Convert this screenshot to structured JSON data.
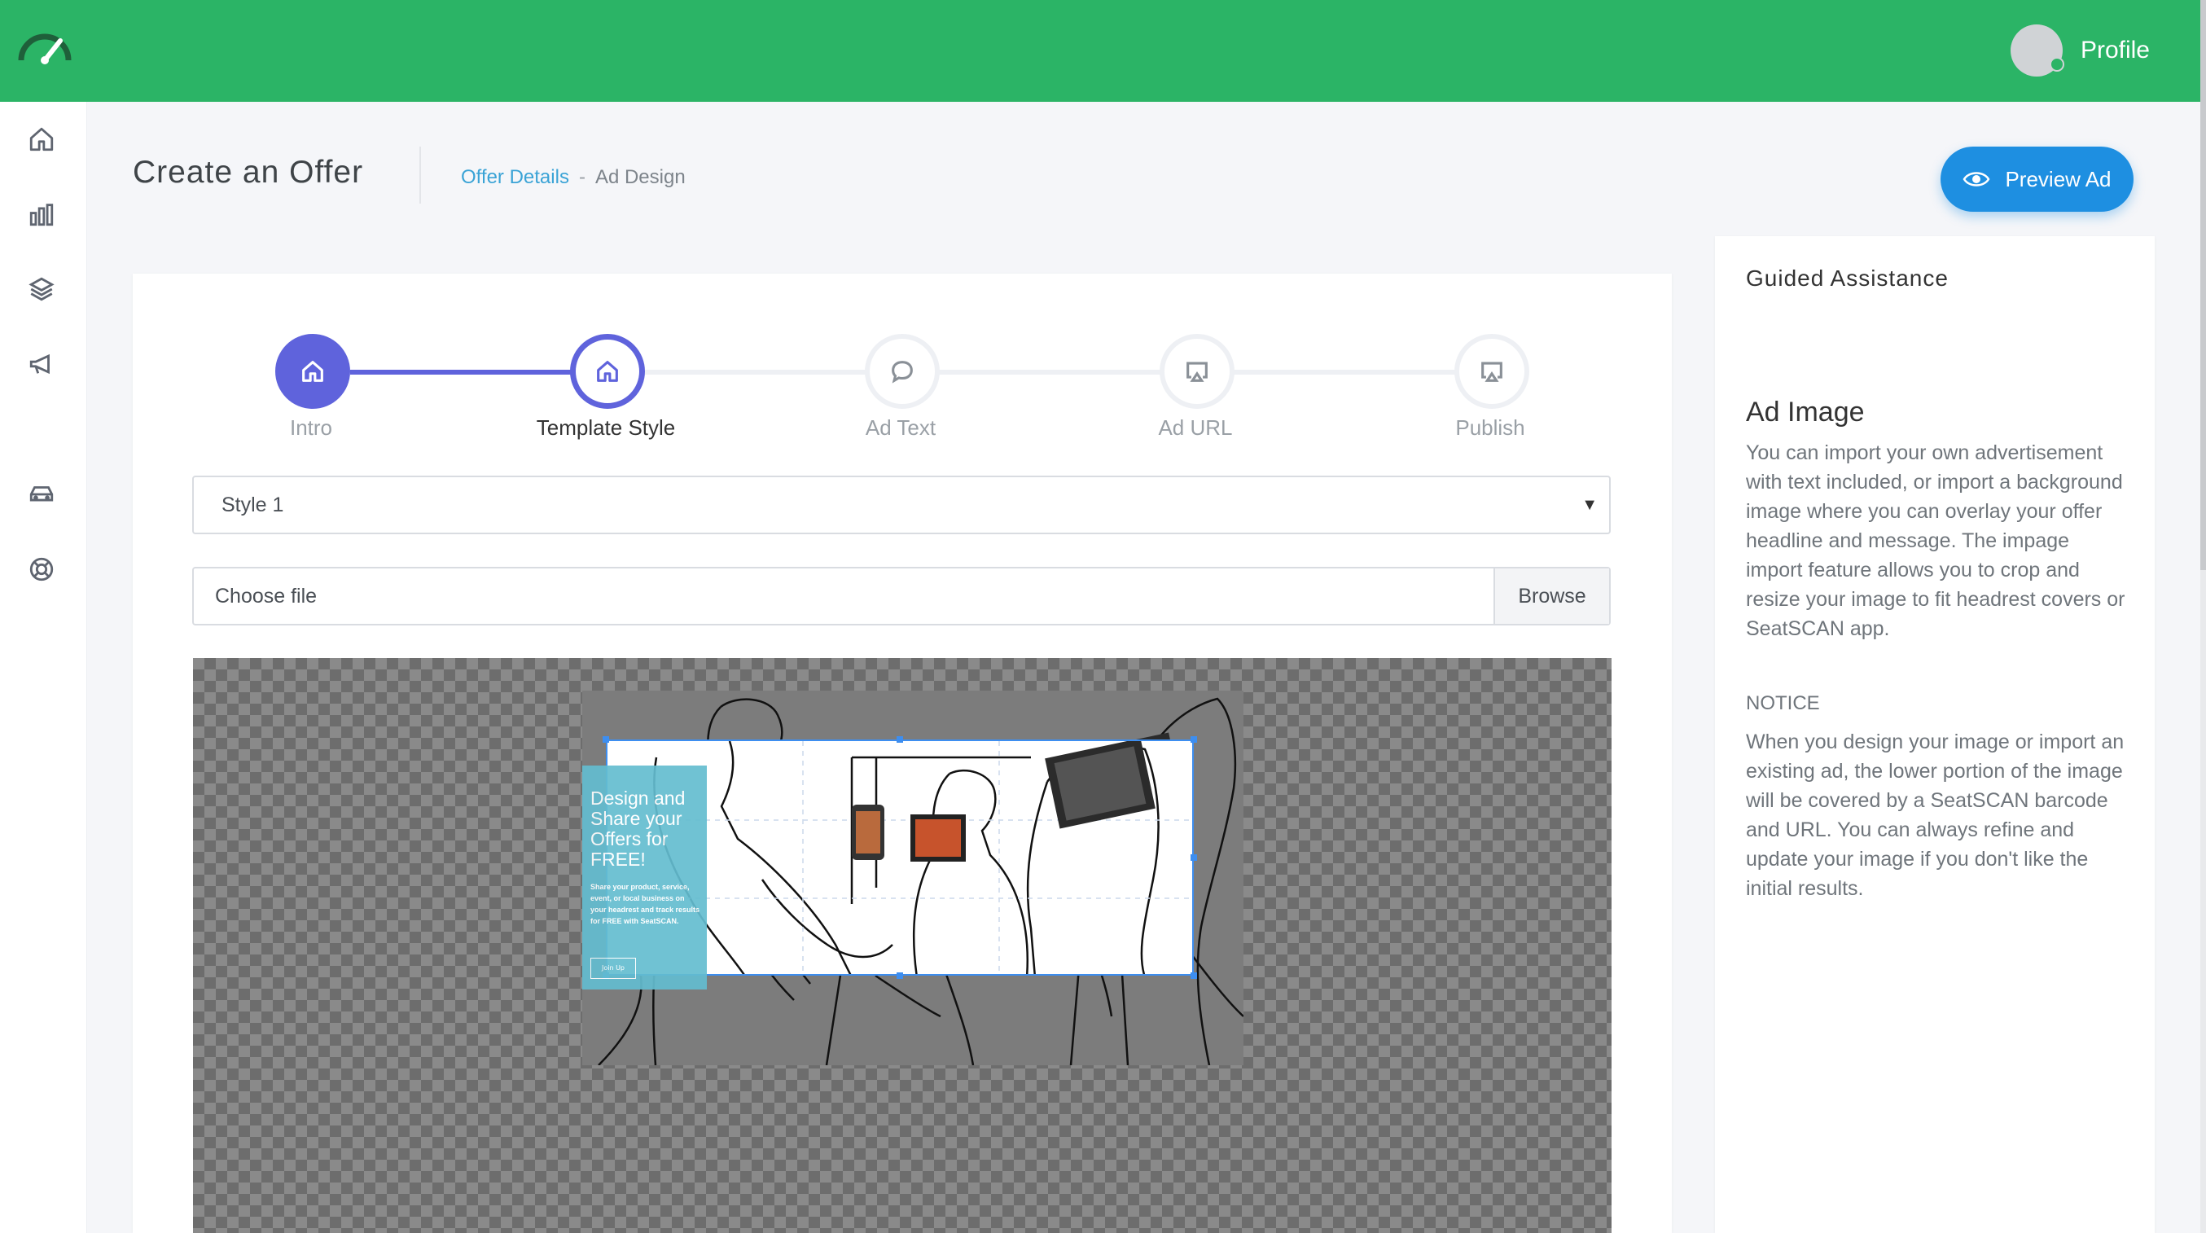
{
  "header": {
    "profile_label": "Profile",
    "brand_color": "#2bb466"
  },
  "sidebar": {
    "items": [
      {
        "icon": "home-icon"
      },
      {
        "icon": "bar-chart-icon"
      },
      {
        "icon": "layers-icon"
      },
      {
        "icon": "megaphone-icon"
      },
      {
        "icon": "car-icon"
      },
      {
        "icon": "lifebuoy-icon"
      }
    ]
  },
  "page": {
    "title": "Create an Offer",
    "breadcrumb": {
      "link": "Offer Details",
      "separator": "-",
      "current": "Ad Design"
    },
    "preview_button": "Preview Ad"
  },
  "stepper": {
    "accent_color": "#5f63dc",
    "steps": [
      {
        "label": "Intro",
        "state": "done",
        "icon": "home-icon"
      },
      {
        "label": "Template Style",
        "state": "active",
        "icon": "home-icon"
      },
      {
        "label": "Ad Text",
        "state": "pending",
        "icon": "chat-bubble-icon"
      },
      {
        "label": "Ad URL",
        "state": "pending",
        "icon": "cast-icon"
      },
      {
        "label": "Publish",
        "state": "pending",
        "icon": "cast-icon"
      }
    ]
  },
  "form": {
    "style_select": {
      "selected": "Style 1"
    },
    "file": {
      "placeholder": "Choose file",
      "browse_label": "Browse"
    }
  },
  "ad_preview": {
    "headline": "Design and Share your Offers for FREE!",
    "body": "Share your product, service, event, or local business on your headrest and track results for FREE with SeatSCAN.",
    "button": "Join Up"
  },
  "guided": {
    "title": "Guided Assistance",
    "heading": "Ad Image",
    "paragraph": "You can import your own advertisement with text included, or import a background image where you can overlay your offer headline and message. The impage import feature allows you to crop and resize your image to fit headrest covers or SeatSCAN app.",
    "notice_label": "NOTICE",
    "notice_text": "When you design your image or import an existing ad, the lower portion of the image will be covered by a SeatSCAN barcode and URL. You can always refine and update your image if you don't like the initial results."
  }
}
